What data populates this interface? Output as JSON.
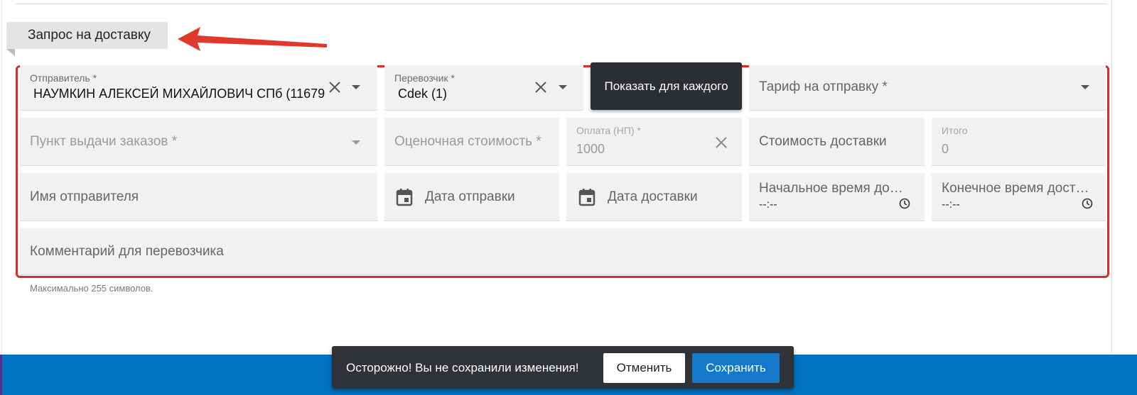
{
  "section": {
    "title": "Запрос на доставку"
  },
  "form": {
    "sender": {
      "label": "Отправитель *",
      "value": "НАУМКИН АЛЕКСЕЙ МИХАЙЛОВИЧ СПб (11679"
    },
    "carrier": {
      "label": "Перевозчик *",
      "value": "Cdek (1)"
    },
    "show_each_button": "Показать для каждого",
    "tariff": {
      "placeholder": "Тариф на отправку *"
    },
    "pickup_point": {
      "placeholder": "Пункт выдачи заказов *"
    },
    "estimated_cost": {
      "placeholder": "Оценочная стоимость *"
    },
    "payment": {
      "label": "Оплата (НП) *",
      "value": "1000"
    },
    "delivery_cost": {
      "placeholder": "Стоимость доставки"
    },
    "total": {
      "label": "Итого",
      "value": "0"
    },
    "sender_name": {
      "placeholder": "Имя отправителя"
    },
    "ship_date": {
      "placeholder": "Дата отправки"
    },
    "delivery_date": {
      "placeholder": "Дата доставки"
    },
    "start_time": {
      "placeholder": "Начальное время до…",
      "value": "--:--"
    },
    "end_time": {
      "placeholder": "Конечное время дост…",
      "value": "--:--"
    },
    "comment": {
      "placeholder": "Комментарий для перевозчика",
      "hint": "Максимально 255 символов."
    }
  },
  "snackbar": {
    "message": "Осторожно! Вы не сохранили изменения!",
    "cancel_label": "Отменить",
    "save_label": "Сохранить"
  },
  "colors": {
    "highlight_frame": "#e02b2b",
    "annotation_arrow": "#e0392b",
    "bottom_bar": "#0073c2",
    "save_button": "#1479c9",
    "tooltip_bg": "#2b2f33"
  }
}
